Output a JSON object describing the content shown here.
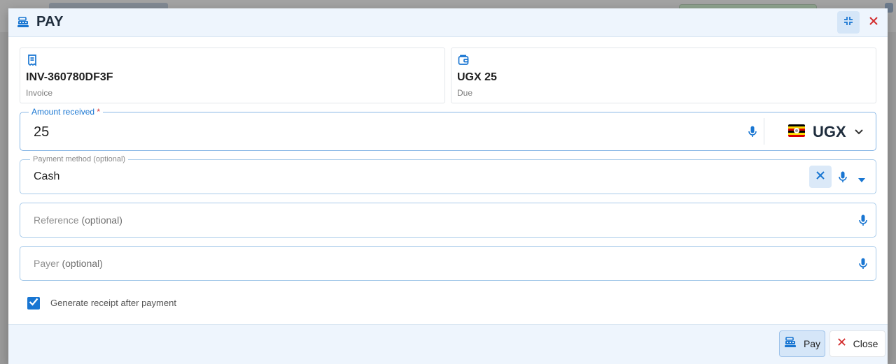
{
  "dialog": {
    "title": "PAY",
    "icons": {
      "title": "cash-register-icon",
      "collapse": "collapse-icon",
      "close": "close-icon"
    }
  },
  "summary": {
    "invoice": {
      "value": "INV-360780DF3F",
      "label": "Invoice",
      "icon": "receipt-icon"
    },
    "due": {
      "value": "UGX 25",
      "label": "Due",
      "icon": "wallet-icon"
    }
  },
  "form": {
    "amount": {
      "label": "Amount received",
      "required_mark": "*",
      "value": "25",
      "currency": "UGX",
      "flag": "uganda-flag"
    },
    "payment_method": {
      "label": "Payment method",
      "label_suffix": "(optional)",
      "value": "Cash"
    },
    "reference": {
      "placeholder": "Reference",
      "placeholder_suffix": "(optional)",
      "value": ""
    },
    "payer": {
      "placeholder": "Payer",
      "placeholder_suffix": "(optional)",
      "value": ""
    },
    "generate_receipt": {
      "label": "Generate receipt after payment",
      "checked": true
    }
  },
  "footer": {
    "pay_label": "Pay",
    "close_label": "Close"
  },
  "colors": {
    "accent": "#1976d2",
    "header_bg": "#eef5fd",
    "danger": "#d32f2f"
  }
}
